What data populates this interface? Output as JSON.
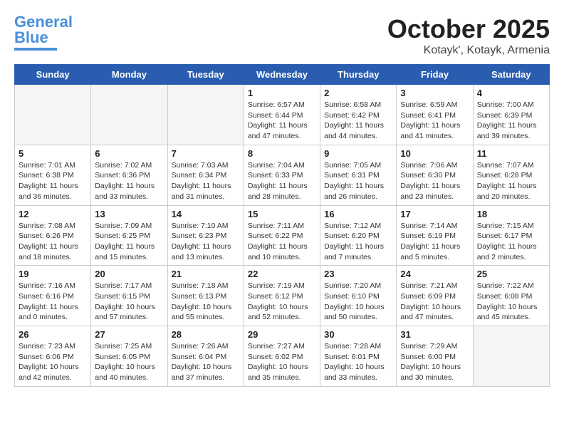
{
  "header": {
    "logo_line1": "General",
    "logo_line2": "Blue",
    "month": "October 2025",
    "location": "Kotayk', Kotayk, Armenia"
  },
  "days_of_week": [
    "Sunday",
    "Monday",
    "Tuesday",
    "Wednesday",
    "Thursday",
    "Friday",
    "Saturday"
  ],
  "weeks": [
    [
      {
        "day": "",
        "info": ""
      },
      {
        "day": "",
        "info": ""
      },
      {
        "day": "",
        "info": ""
      },
      {
        "day": "1",
        "info": "Sunrise: 6:57 AM\nSunset: 6:44 PM\nDaylight: 11 hours and 47 minutes."
      },
      {
        "day": "2",
        "info": "Sunrise: 6:58 AM\nSunset: 6:42 PM\nDaylight: 11 hours and 44 minutes."
      },
      {
        "day": "3",
        "info": "Sunrise: 6:59 AM\nSunset: 6:41 PM\nDaylight: 11 hours and 41 minutes."
      },
      {
        "day": "4",
        "info": "Sunrise: 7:00 AM\nSunset: 6:39 PM\nDaylight: 11 hours and 39 minutes."
      }
    ],
    [
      {
        "day": "5",
        "info": "Sunrise: 7:01 AM\nSunset: 6:38 PM\nDaylight: 11 hours and 36 minutes."
      },
      {
        "day": "6",
        "info": "Sunrise: 7:02 AM\nSunset: 6:36 PM\nDaylight: 11 hours and 33 minutes."
      },
      {
        "day": "7",
        "info": "Sunrise: 7:03 AM\nSunset: 6:34 PM\nDaylight: 11 hours and 31 minutes."
      },
      {
        "day": "8",
        "info": "Sunrise: 7:04 AM\nSunset: 6:33 PM\nDaylight: 11 hours and 28 minutes."
      },
      {
        "day": "9",
        "info": "Sunrise: 7:05 AM\nSunset: 6:31 PM\nDaylight: 11 hours and 26 minutes."
      },
      {
        "day": "10",
        "info": "Sunrise: 7:06 AM\nSunset: 6:30 PM\nDaylight: 11 hours and 23 minutes."
      },
      {
        "day": "11",
        "info": "Sunrise: 7:07 AM\nSunset: 6:28 PM\nDaylight: 11 hours and 20 minutes."
      }
    ],
    [
      {
        "day": "12",
        "info": "Sunrise: 7:08 AM\nSunset: 6:26 PM\nDaylight: 11 hours and 18 minutes."
      },
      {
        "day": "13",
        "info": "Sunrise: 7:09 AM\nSunset: 6:25 PM\nDaylight: 11 hours and 15 minutes."
      },
      {
        "day": "14",
        "info": "Sunrise: 7:10 AM\nSunset: 6:23 PM\nDaylight: 11 hours and 13 minutes."
      },
      {
        "day": "15",
        "info": "Sunrise: 7:11 AM\nSunset: 6:22 PM\nDaylight: 11 hours and 10 minutes."
      },
      {
        "day": "16",
        "info": "Sunrise: 7:12 AM\nSunset: 6:20 PM\nDaylight: 11 hours and 7 minutes."
      },
      {
        "day": "17",
        "info": "Sunrise: 7:14 AM\nSunset: 6:19 PM\nDaylight: 11 hours and 5 minutes."
      },
      {
        "day": "18",
        "info": "Sunrise: 7:15 AM\nSunset: 6:17 PM\nDaylight: 11 hours and 2 minutes."
      }
    ],
    [
      {
        "day": "19",
        "info": "Sunrise: 7:16 AM\nSunset: 6:16 PM\nDaylight: 11 hours and 0 minutes."
      },
      {
        "day": "20",
        "info": "Sunrise: 7:17 AM\nSunset: 6:15 PM\nDaylight: 10 hours and 57 minutes."
      },
      {
        "day": "21",
        "info": "Sunrise: 7:18 AM\nSunset: 6:13 PM\nDaylight: 10 hours and 55 minutes."
      },
      {
        "day": "22",
        "info": "Sunrise: 7:19 AM\nSunset: 6:12 PM\nDaylight: 10 hours and 52 minutes."
      },
      {
        "day": "23",
        "info": "Sunrise: 7:20 AM\nSunset: 6:10 PM\nDaylight: 10 hours and 50 minutes."
      },
      {
        "day": "24",
        "info": "Sunrise: 7:21 AM\nSunset: 6:09 PM\nDaylight: 10 hours and 47 minutes."
      },
      {
        "day": "25",
        "info": "Sunrise: 7:22 AM\nSunset: 6:08 PM\nDaylight: 10 hours and 45 minutes."
      }
    ],
    [
      {
        "day": "26",
        "info": "Sunrise: 7:23 AM\nSunset: 6:06 PM\nDaylight: 10 hours and 42 minutes."
      },
      {
        "day": "27",
        "info": "Sunrise: 7:25 AM\nSunset: 6:05 PM\nDaylight: 10 hours and 40 minutes."
      },
      {
        "day": "28",
        "info": "Sunrise: 7:26 AM\nSunset: 6:04 PM\nDaylight: 10 hours and 37 minutes."
      },
      {
        "day": "29",
        "info": "Sunrise: 7:27 AM\nSunset: 6:02 PM\nDaylight: 10 hours and 35 minutes."
      },
      {
        "day": "30",
        "info": "Sunrise: 7:28 AM\nSunset: 6:01 PM\nDaylight: 10 hours and 33 minutes."
      },
      {
        "day": "31",
        "info": "Sunrise: 7:29 AM\nSunset: 6:00 PM\nDaylight: 10 hours and 30 minutes."
      },
      {
        "day": "",
        "info": ""
      }
    ]
  ]
}
